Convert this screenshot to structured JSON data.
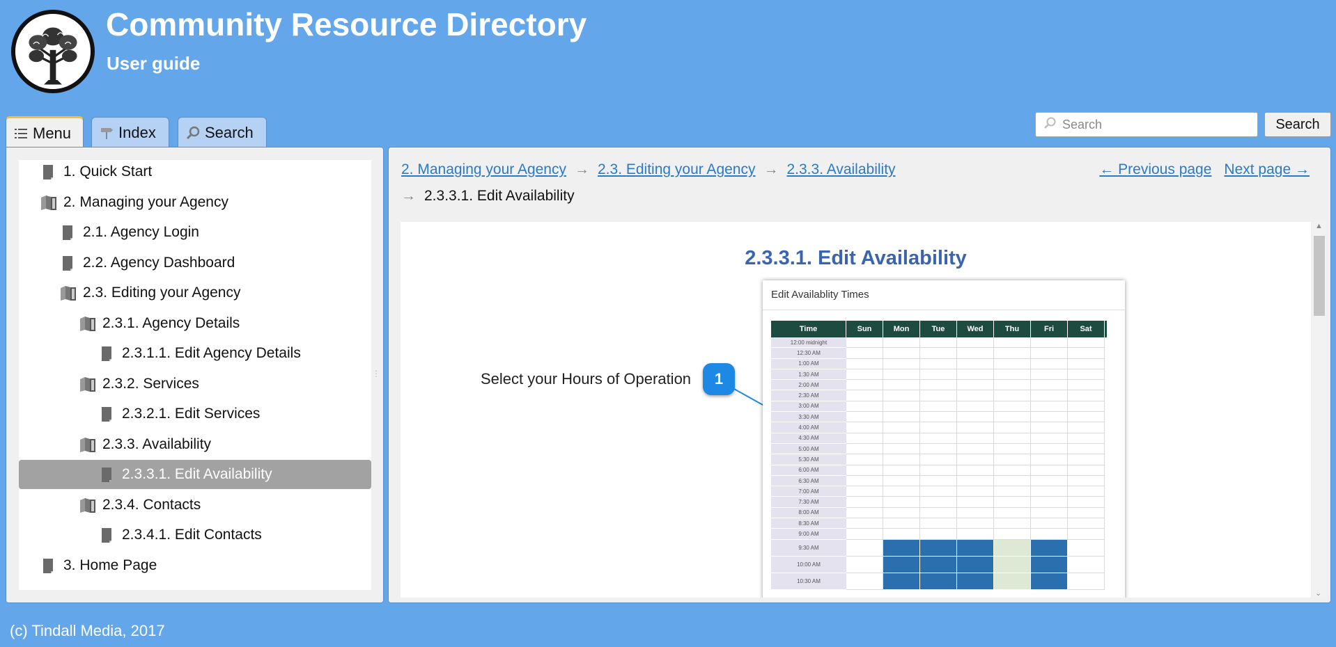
{
  "header": {
    "title": "Community Resource Directory",
    "subtitle": "User guide",
    "logo_icon": "tree-logo"
  },
  "tabs": [
    {
      "label": "Menu",
      "icon": "list-icon",
      "active": true
    },
    {
      "label": "Index",
      "icon": "signpost-icon",
      "active": false
    },
    {
      "label": "Search",
      "icon": "magnifier-icon",
      "active": false
    }
  ],
  "search": {
    "placeholder": "Search",
    "button_label": "Search"
  },
  "menu": {
    "items": [
      {
        "label": "1. Quick Start",
        "type": "page"
      },
      {
        "label": "2. Managing your Agency",
        "type": "book"
      },
      {
        "label": "2.1. Agency Login",
        "type": "page"
      },
      {
        "label": "2.2. Agency Dashboard",
        "type": "page"
      },
      {
        "label": "2.3. Editing your Agency",
        "type": "book"
      },
      {
        "label": "2.3.1. Agency Details",
        "type": "book"
      },
      {
        "label": "2.3.1.1. Edit Agency Details",
        "type": "page"
      },
      {
        "label": "2.3.2. Services",
        "type": "book"
      },
      {
        "label": "2.3.2.1. Edit Services",
        "type": "page"
      },
      {
        "label": "2.3.3. Availability",
        "type": "book"
      },
      {
        "label": "2.3.3.1. Edit Availability",
        "type": "page",
        "selected": true
      },
      {
        "label": "2.3.4. Contacts",
        "type": "book"
      },
      {
        "label": "2.3.4.1. Edit Contacts",
        "type": "page"
      },
      {
        "label": "3. Home Page",
        "type": "page"
      }
    ]
  },
  "breadcrumb": {
    "links": [
      "2. Managing your Agency",
      "2.3. Editing your Agency",
      "2.3.3. Availability"
    ],
    "current": "2.3.3.1. Edit Availability",
    "separator": "→"
  },
  "pager": {
    "prev": "← Previous page",
    "next": "Next page →"
  },
  "topic": {
    "title": "2.3.3.1. Edit Availability",
    "step_text": "Select your Hours of Operation",
    "step_number": "1",
    "screenshot": {
      "title": "Edit Availablity Times",
      "columns": [
        "Time",
        "Sun",
        "Mon",
        "Tue",
        "Wed",
        "Thu",
        "Fri",
        "Sat"
      ],
      "times": [
        "12:00 midnight",
        "12:30 AM",
        "1:00 AM",
        "1:30 AM",
        "2:00 AM",
        "2:30 AM",
        "3:00 AM",
        "3:30 AM",
        "4:00 AM",
        "4:30 AM",
        "5:00 AM",
        "5:30 AM",
        "6:00 AM",
        "6:30 AM",
        "7:00 AM",
        "7:30 AM",
        "8:00 AM",
        "8:30 AM",
        "9:00 AM",
        "9:30 AM",
        "10:00 AM",
        "10:30 AM"
      ]
    }
  },
  "footer": {
    "text": "(c) Tindall Media, 2017"
  },
  "colors": {
    "background": "#64a6ea",
    "link": "#2a7ac5",
    "topic_title": "#3a63b0",
    "grid_header": "#1d4b3f",
    "selected_slot": "#2c6fae",
    "thursday_slot": "#dde9d5",
    "step_badge": "#1e88e5"
  }
}
